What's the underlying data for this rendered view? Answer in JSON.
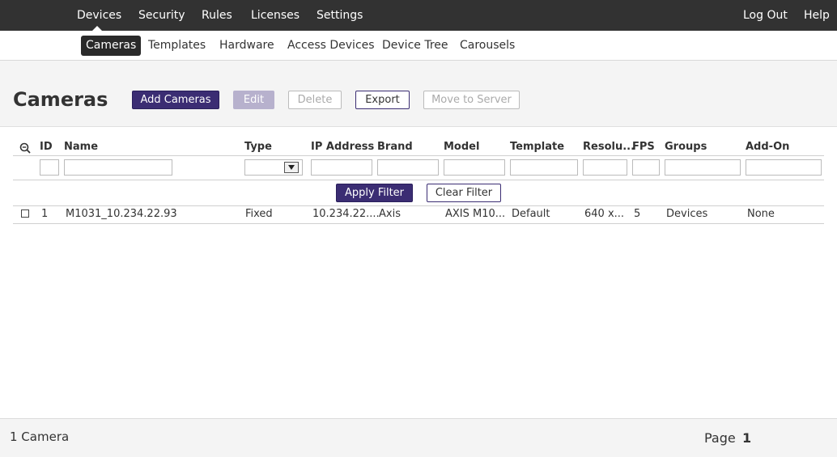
{
  "top_nav": {
    "items": [
      "Devices",
      "Security",
      "Rules",
      "Licenses",
      "Settings"
    ],
    "logout": "Log Out",
    "help": "Help"
  },
  "sub_nav": {
    "items": [
      "Cameras",
      "Templates",
      "Hardware",
      "Access Devices",
      "Device Tree",
      "Carousels"
    ],
    "active": "Cameras"
  },
  "page": {
    "title": "Cameras",
    "buttons": {
      "add": "Add Cameras",
      "edit": "Edit",
      "delete": "Delete",
      "export": "Export",
      "move": "Move to Server"
    }
  },
  "table": {
    "columns": [
      "ID",
      "Name",
      "Type",
      "IP Address",
      "Brand",
      "Model",
      "Template",
      "Resolu...",
      "FPS",
      "Groups",
      "Add-On"
    ],
    "filter_buttons": {
      "apply": "Apply Filter",
      "clear": "Clear Filter"
    },
    "rows": [
      {
        "id": "1",
        "name": "M1031_10.234.22.93",
        "type": "Fixed",
        "ip": "10.234.22....",
        "brand": "Axis",
        "model": "AXIS M10...",
        "template": "Default",
        "resolution": "640 x...",
        "fps": "5",
        "groups": "Devices",
        "addon": "None"
      }
    ]
  },
  "footer": {
    "count": "1 Camera",
    "page_label": "Page",
    "page_number": "1"
  },
  "colors": {
    "topbar": "#323232",
    "primary": "#3b2d73",
    "band": "#f4f4f4"
  }
}
